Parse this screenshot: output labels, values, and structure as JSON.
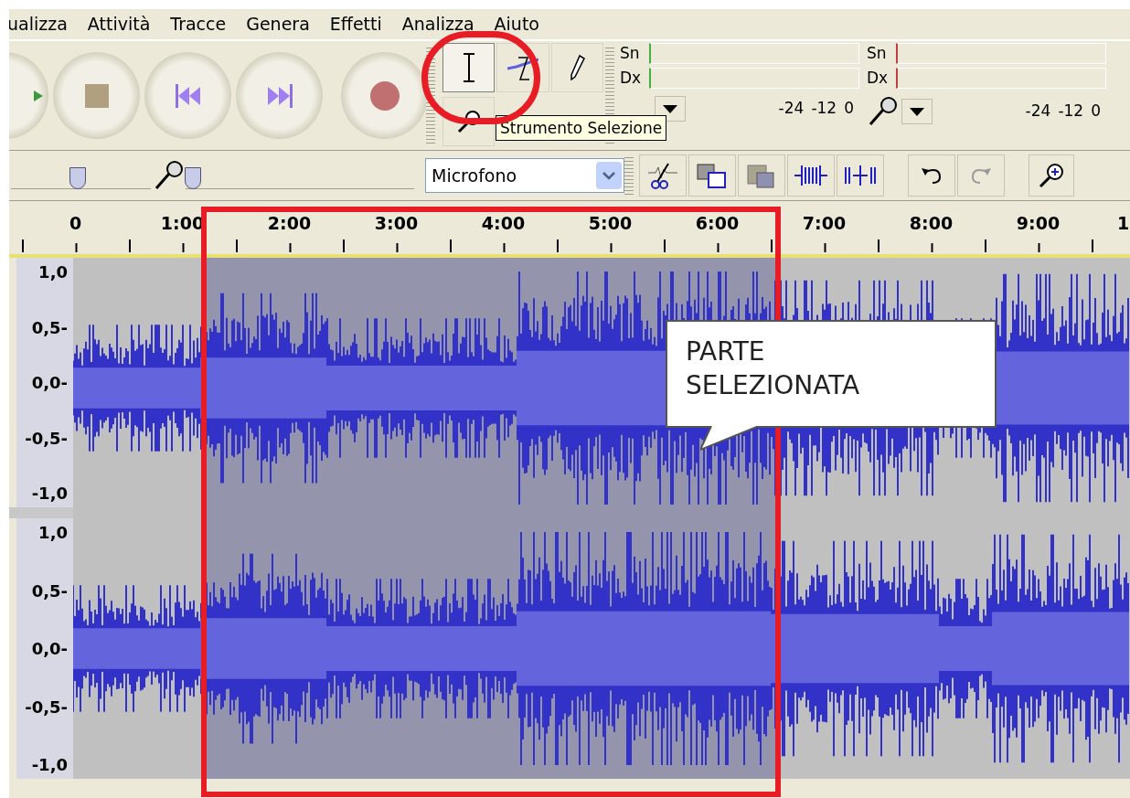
{
  "menu": [
    "ualizza",
    "Attività",
    "Tracce",
    "Genera",
    "Effetti",
    "Analizza",
    "Aiuto"
  ],
  "transport": [
    {
      "kind": "play"
    },
    {
      "kind": "stop"
    },
    {
      "kind": "rewind"
    },
    {
      "kind": "forward"
    },
    {
      "kind": "record"
    }
  ],
  "tools": [
    {
      "kind": "select",
      "selected": true
    },
    {
      "kind": "envelope",
      "selected": false
    },
    {
      "kind": "draw",
      "selected": false
    },
    {
      "kind": "zoom",
      "selected": false
    }
  ],
  "tooltip": "Strumento Selezione",
  "meters": [
    {
      "kind": "play",
      "channels": [
        "Sn",
        "Dx"
      ],
      "scale": [
        "-24",
        "-12",
        "0"
      ]
    },
    {
      "kind": "record",
      "channels": [
        "Sn",
        "Dx"
      ],
      "scale": [
        "-24",
        "-12",
        "0"
      ]
    }
  ],
  "sliders": [
    {
      "kind": "gain",
      "level": 0.48
    },
    {
      "kind": "input",
      "level": 0.03
    }
  ],
  "input_source": "Microfono",
  "ruler": [
    "0",
    "1:00",
    "2:00",
    "3:00",
    "4:00",
    "5:00",
    "6:00",
    "7:00",
    "8:00",
    "9:00",
    "1"
  ],
  "tracks": [
    {
      "axis": [
        "1,0",
        "0,5-",
        "0,0-",
        "-0,5-",
        "-1,0"
      ]
    },
    {
      "axis": [
        "1,0",
        "0,5-",
        "0,0-",
        "-0,5-",
        "-1,0"
      ]
    }
  ],
  "callout": "PARTE SELEZIONATA"
}
